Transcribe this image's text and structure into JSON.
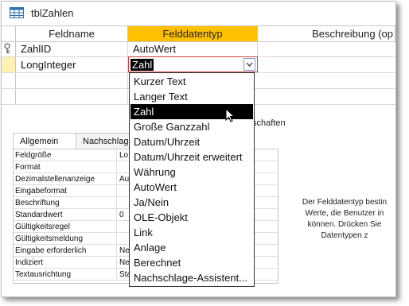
{
  "window": {
    "title": "tblZahlen"
  },
  "grid": {
    "headers": {
      "field_name": "Feldname",
      "field_type": "Felddatentyp",
      "description": "Beschreibung (op"
    },
    "rows": [
      {
        "name": "ZahlID",
        "type": "AutoWert",
        "key": true
      },
      {
        "name": "LongInteger",
        "type": "Zahl",
        "key": false
      }
    ]
  },
  "combo": {
    "value": "Zahl"
  },
  "dropdown": {
    "options": [
      "Kurzer Text",
      "Langer Text",
      "Zahl",
      "Große Ganzzahl",
      "Datum/Uhrzeit",
      "Datum/Uhrzeit erweitert",
      "Währung",
      "AutoWert",
      "Ja/Nein",
      "OLE-Objekt",
      "Link",
      "Anlage",
      "Berechnet",
      "Nachschlage-Assistent..."
    ],
    "highlighted": "Zahl"
  },
  "properties": {
    "section_label": "schaften",
    "tabs": [
      "Allgemein",
      "Nachschlagen"
    ],
    "rows": [
      {
        "name": "Feldgröße",
        "value": "Lo"
      },
      {
        "name": "Format",
        "value": ""
      },
      {
        "name": "Dezimalstellenanzeige",
        "value": "Au"
      },
      {
        "name": "Eingabeformat",
        "value": ""
      },
      {
        "name": "Beschriftung",
        "value": ""
      },
      {
        "name": "Standardwert",
        "value": "0"
      },
      {
        "name": "Gültigkeitsregel",
        "value": ""
      },
      {
        "name": "Gültigkeitsmeldung",
        "value": ""
      },
      {
        "name": "Eingabe erforderlich",
        "value": "Ne"
      },
      {
        "name": "Indiziert",
        "value": "Ne"
      },
      {
        "name": "Textausrichtung",
        "value": "Sta"
      }
    ]
  },
  "help_text": [
    "Der Felddatentyp bestin",
    "Werte, die Benutzer in",
    "können. Drücken Sie",
    "Datentypen z"
  ],
  "colors": {
    "header_active": "#ffc000",
    "row_marker": "#fff2b3",
    "selection": "#000000",
    "combo_border": "#d04040"
  }
}
